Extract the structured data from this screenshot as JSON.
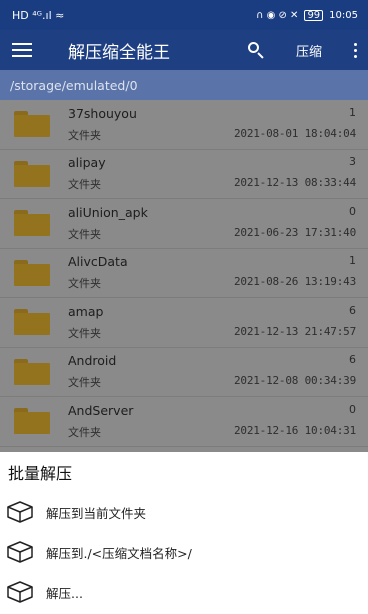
{
  "status_bar": {
    "left_indicators": "HD ⁴ᴳ.ıl ≈",
    "right_icons": "∩ ◉ ⊘ ✕",
    "battery": "99",
    "time": "10:05"
  },
  "app_bar": {
    "title": "解压缩全能王",
    "compress_label": "压缩"
  },
  "path": "/storage/emulated/0",
  "files": [
    {
      "name": "37shouyou",
      "type": "文件夹",
      "count": "1",
      "date": "2021-08-01 18:04:04"
    },
    {
      "name": "alipay",
      "type": "文件夹",
      "count": "3",
      "date": "2021-12-13 08:33:44"
    },
    {
      "name": "aliUnion_apk",
      "type": "文件夹",
      "count": "0",
      "date": "2021-06-23 17:31:40"
    },
    {
      "name": "AlivcData",
      "type": "文件夹",
      "count": "1",
      "date": "2021-08-26 13:19:43"
    },
    {
      "name": "amap",
      "type": "文件夹",
      "count": "6",
      "date": "2021-12-13 21:47:57"
    },
    {
      "name": "Android",
      "type": "文件夹",
      "count": "6",
      "date": "2021-12-08 00:34:39"
    },
    {
      "name": "AndServer",
      "type": "文件夹",
      "count": "0",
      "date": "2021-12-16 10:04:31"
    }
  ],
  "sheet": {
    "title": "批量解压",
    "items": [
      {
        "label": "解压到当前文件夹"
      },
      {
        "label": "解压到./<压缩文档名称>/"
      },
      {
        "label": "解压..."
      }
    ]
  },
  "icons": [
    "menu-icon",
    "search-icon",
    "more-icon",
    "folder-icon",
    "box-icon"
  ],
  "colors": {
    "app_bar": "#1e3f82",
    "path_bar": "#5a73a8",
    "list_dimmed": "#8a8a8a",
    "folder": "#94731f"
  }
}
